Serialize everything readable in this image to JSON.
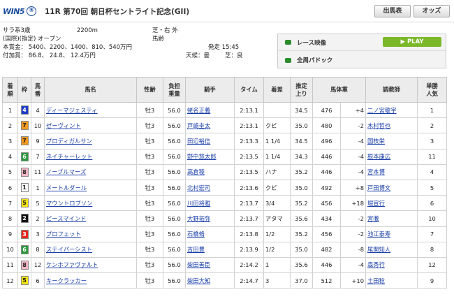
{
  "header": {
    "logo": "WIN5",
    "logo_leg": "⑤",
    "title": "11R 第70回 朝日杯セントライト記念(GII)",
    "btn_entries": "出馬表",
    "btn_odds": "オッズ"
  },
  "info": {
    "class": "サラ系3歳",
    "distance": "2200m",
    "course": "芝・右 外",
    "conditions": "(国際)(指定) オープン",
    "weight_rule": "馬齢",
    "prize": "本賞金： 5400、2200、1400、810、540万円",
    "added": "付加賞： 86.8、 24.8、 12.4万円",
    "post_time": "発走 15:45",
    "weather": "天候：曇",
    "going": "芝：良"
  },
  "media": {
    "video": "レース映像",
    "play": "PLAY",
    "paddock": "全周パドック"
  },
  "table": {
    "headers": [
      "着順",
      "枠",
      "馬番",
      "馬名",
      "性齢",
      "負担重量",
      "騎手",
      "タイム",
      "着差",
      "推定上り",
      "馬体重",
      "",
      "調教師",
      "単勝人気"
    ],
    "rows": [
      [
        "1",
        "4",
        "4",
        "ディーマジェスティ",
        "牡3",
        "56.0",
        "蛯名正義",
        "2:13.1",
        "",
        "34.5",
        "476",
        "+4",
        "二ノ宮敬宇",
        "1"
      ],
      [
        "2",
        "7",
        "10",
        "ゼーヴィント",
        "牡3",
        "56.0",
        "戸崎圭太",
        "2:13.1",
        "クビ",
        "35.0",
        "480",
        "-2",
        "木村哲也",
        "2"
      ],
      [
        "3",
        "7",
        "9",
        "プロディガルサン",
        "牡3",
        "56.0",
        "田辺裕信",
        "2:13.3",
        "1 1/4",
        "34.5",
        "496",
        "-4",
        "国枝栄",
        "3"
      ],
      [
        "4",
        "6",
        "7",
        "ネイチャーレット",
        "牡3",
        "56.0",
        "野中悠太郎",
        "2:13.5",
        "1 1/4",
        "34.3",
        "446",
        "-4",
        "根本康広",
        "11"
      ],
      [
        "5",
        "8",
        "11",
        "ノーブルマーズ",
        "牡3",
        "56.0",
        "高倉稜",
        "2:13.5",
        "ハナ",
        "35.2",
        "446",
        "-4",
        "宮本博",
        "4"
      ],
      [
        "6",
        "1",
        "1",
        "メートルダール",
        "牡3",
        "56.0",
        "北村宏司",
        "2:13.6",
        "クビ",
        "35.0",
        "492",
        "+8",
        "戸田博文",
        "5"
      ],
      [
        "7",
        "5",
        "5",
        "マウントロブソン",
        "牡3",
        "56.0",
        "川田将雅",
        "2:13.7",
        "3/4",
        "35.2",
        "456",
        "+18",
        "堀宣行",
        "6"
      ],
      [
        "8",
        "2",
        "2",
        "ピースマインド",
        "牡3",
        "56.0",
        "大野拓弥",
        "2:13.7",
        "アタマ",
        "35.6",
        "434",
        "-2",
        "宮徹",
        "10"
      ],
      [
        "9",
        "3",
        "3",
        "プロフェット",
        "牡3",
        "56.0",
        "石橋脩",
        "2:13.8",
        "1/2",
        "35.2",
        "456",
        "-2",
        "池江泰寿",
        "7"
      ],
      [
        "10",
        "6",
        "8",
        "ステイパーシスト",
        "牡3",
        "56.0",
        "吉田豊",
        "2:13.9",
        "1/2",
        "35.0",
        "482",
        "-8",
        "尾関知人",
        "8"
      ],
      [
        "11",
        "8",
        "12",
        "ケンホファヴァルト",
        "牡3",
        "56.0",
        "柴田善臣",
        "2:14.2",
        "1",
        "35.6",
        "446",
        "-4",
        "森秀行",
        "12"
      ],
      [
        "12",
        "5",
        "6",
        "キークラッカー",
        "牡3",
        "56.0",
        "柴田大知",
        "2:14.7",
        "3",
        "37.0",
        "512",
        "+10",
        "土田稔",
        "9"
      ]
    ]
  },
  "waku_colors": {
    "1": [
      "#ffffff",
      "#222"
    ],
    "2": [
      "#111111",
      "#fff"
    ],
    "3": [
      "#e8281c",
      "#fff"
    ],
    "4": [
      "#1d3cc9",
      "#fff"
    ],
    "5": [
      "#f3e312",
      "#222"
    ],
    "6": [
      "#2b9a3d",
      "#fff"
    ],
    "7": [
      "#f39a1e",
      "#222"
    ],
    "8": [
      "#f4b7c6",
      "#222"
    ]
  },
  "links": [
    "name",
    "jockey",
    "trainer"
  ]
}
